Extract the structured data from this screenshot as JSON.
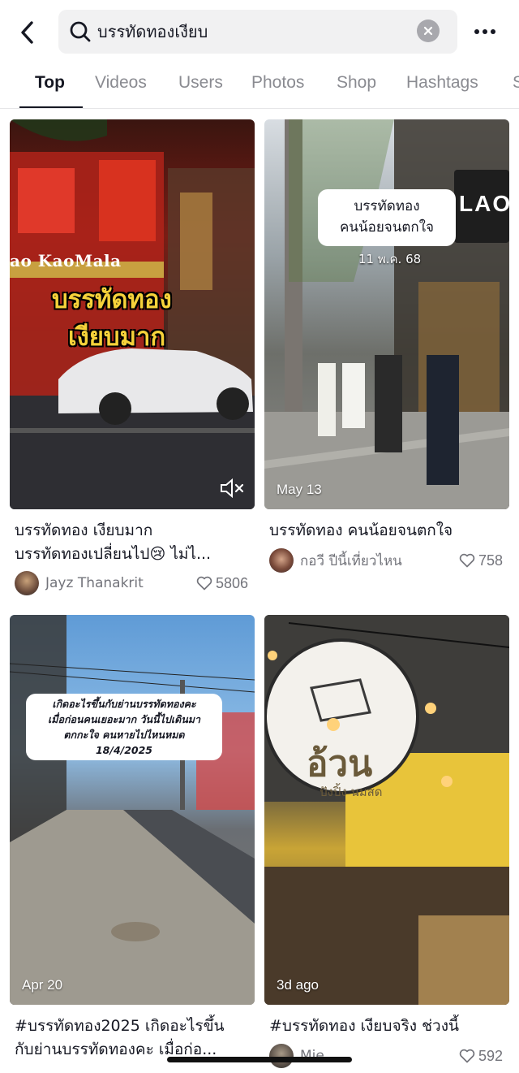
{
  "search": {
    "query": "บรรทัดทองเงียบ"
  },
  "tabs": [
    "Top",
    "Videos",
    "Users",
    "Photos",
    "Shop",
    "Hashtags",
    "S"
  ],
  "cards": [
    {
      "title_line1": "บรรทัดทอง เงียบมาก",
      "title_line2": "บรรทัดทองเปลี่ยนไป😢 ไม่ไ...",
      "author": "Jayz Thanakrit",
      "likes": "5806",
      "overlay_line1": "บรรทัดทอง",
      "overlay_line2": "เงียบมาก",
      "sign_text": "ao KaoMala"
    },
    {
      "date": "May 13",
      "title_line1": "บรรทัดทอง คนน้อยจนตกใจ",
      "author": "กอวี ปีนี้เที่ยวไหน",
      "likes": "758",
      "bubble_line1": "บรรทัดทอง",
      "bubble_line2": "คนน้อยจนตกใจ",
      "bubble_sub": "11 พ.ค. 68",
      "sign_text": "LAO"
    },
    {
      "date": "Apr 20",
      "title_line1": "#บรรทัดทอง2025 เกิดอะไรขึ้น",
      "title_line2": "กับย่านบรรทัดทองคะ เมื่อก่อ...",
      "overlay_line1": "เกิดอะไรขึ้นกับย่านบรรทัดทองคะ",
      "overlay_line2": "เมื่อก่อนคนเยอะมาก วันนี้ไปเดินมา",
      "overlay_line3": "ตกกะใจ คนหายไปไหนหมด",
      "overlay_line4": "18/4/2025"
    },
    {
      "date": "3d ago",
      "title_line1": "#บรรทัดทอง เงียบจริง ช่วงนี้",
      "author": "Mie",
      "likes": "592",
      "sign_big": "อ้วน",
      "sign_small": "ปังปิ้ง นมสด"
    }
  ],
  "colors": {
    "text": "#161823",
    "muted": "#73747b",
    "tab_inactive": "#8a8b91",
    "search_bg": "#f1f1f2"
  }
}
